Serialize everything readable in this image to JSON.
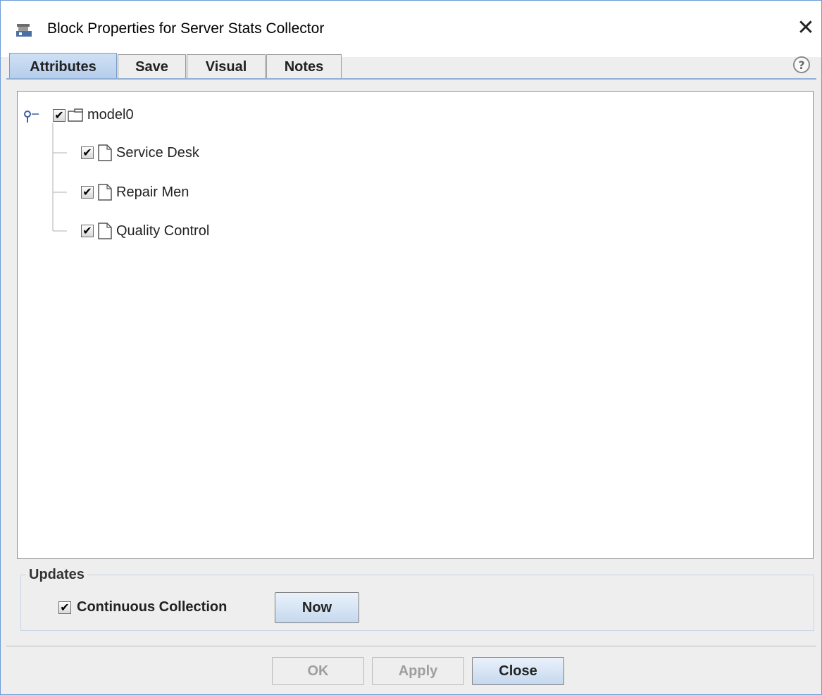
{
  "window": {
    "title": "Block Properties for Server Stats Collector",
    "icon": "block-app-icon",
    "close_icon": "close-icon"
  },
  "tabs": [
    {
      "label": "Attributes",
      "active": true
    },
    {
      "label": "Save",
      "active": false
    },
    {
      "label": "Visual",
      "active": false
    },
    {
      "label": "Notes",
      "active": false
    }
  ],
  "tree": {
    "root": {
      "label": "model0",
      "checked": true,
      "icon": "folder-icon"
    },
    "children": [
      {
        "label": "Service Desk",
        "checked": true,
        "icon": "document-icon"
      },
      {
        "label": "Repair Men",
        "checked": true,
        "icon": "document-icon"
      },
      {
        "label": "Quality Control",
        "checked": true,
        "icon": "document-icon"
      }
    ]
  },
  "updates": {
    "title": "Updates",
    "continuous_label": "Continuous Collection",
    "continuous_checked": true,
    "now_label": "Now"
  },
  "buttons": {
    "ok": {
      "label": "OK",
      "enabled": false
    },
    "apply": {
      "label": "Apply",
      "enabled": false
    },
    "close": {
      "label": "Close",
      "enabled": true
    }
  },
  "colors": {
    "tab_active": "#b4cdeb",
    "border_accent": "#6d9bd6"
  }
}
